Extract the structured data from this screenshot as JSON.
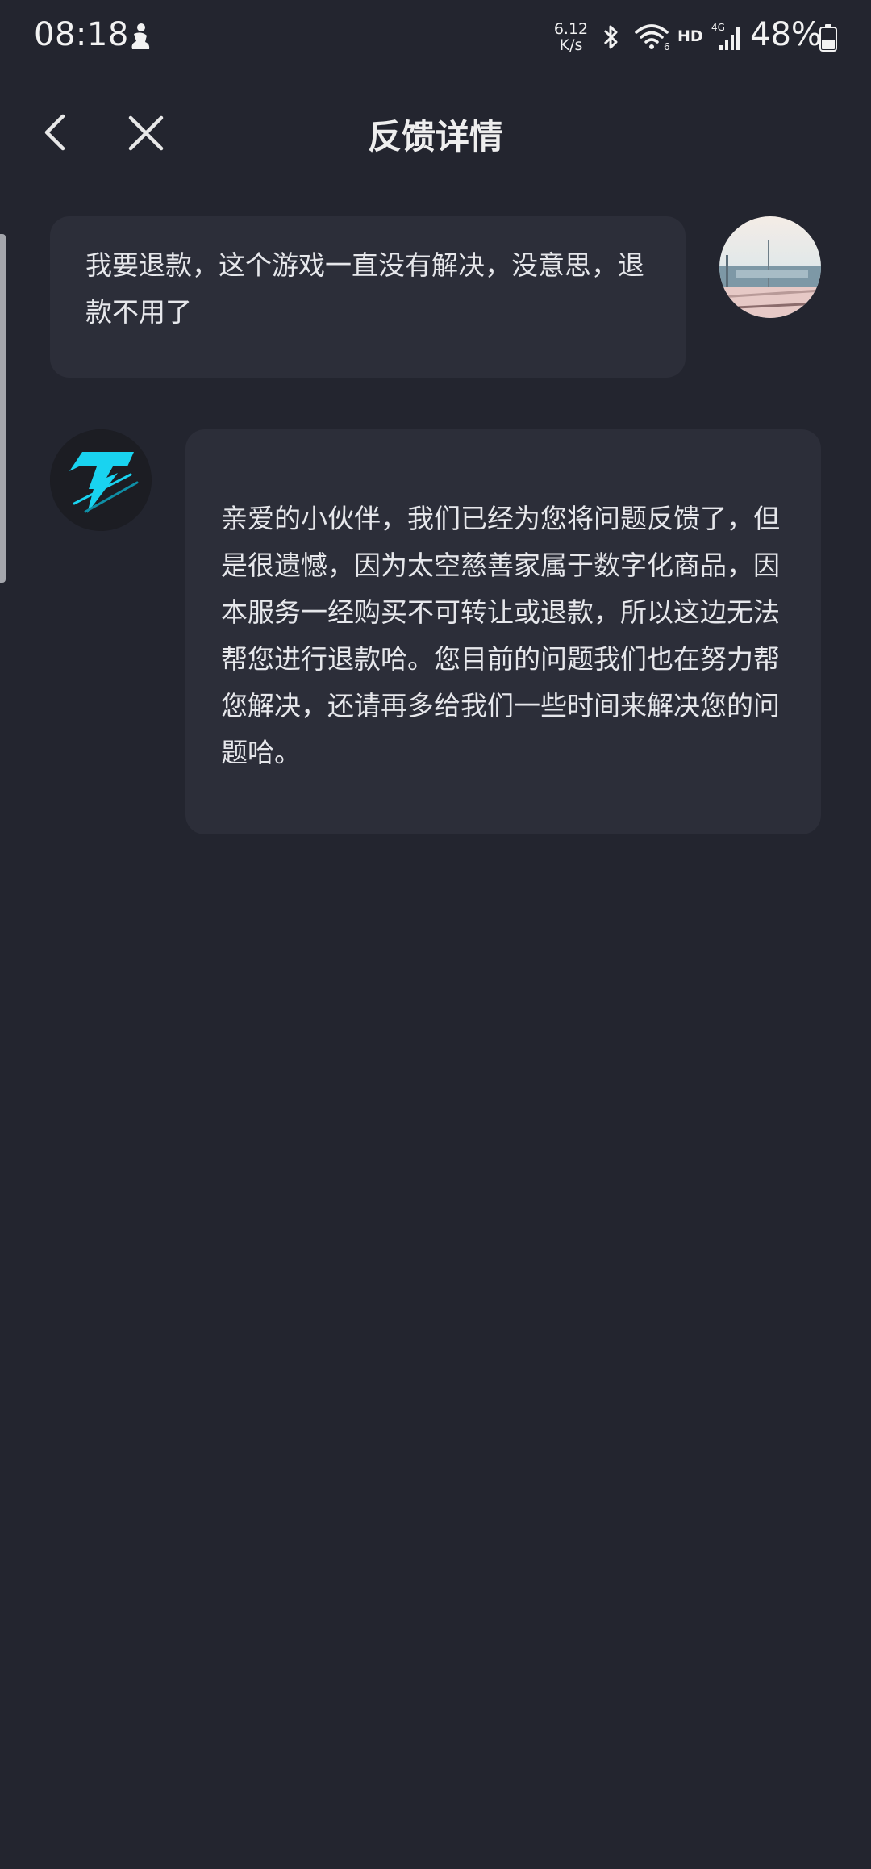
{
  "status_bar": {
    "time": "08:18",
    "net_speed_value": "6.12",
    "net_speed_unit": "K/s",
    "hd_label": "HD",
    "battery": "48%"
  },
  "header": {
    "title": "反馈详情"
  },
  "messages": [
    {
      "sender": "user",
      "text": "我要退款，这个游戏一直没有解决，没意思，退款不用了"
    },
    {
      "sender": "support",
      "text": "亲爱的小伙伴，我们已经为您将问题反馈了，但是很遗憾，因为太空慈善家属于数字化商品，因本服务一经购买不可转让或退款，所以这边无法帮您进行退款哈。您目前的问题我们也在努力帮您解决，还请再多给我们一些时间来解决您的问题哈。"
    }
  ],
  "colors": {
    "background": "#23252f",
    "bubble": "#2c2e39",
    "text": "#e6e7eb",
    "brand_cyan": "#19d3f0"
  },
  "icons": {
    "back": "chevron-left-icon",
    "close": "close-icon",
    "support_logo": "lightning-t-logo-icon"
  }
}
